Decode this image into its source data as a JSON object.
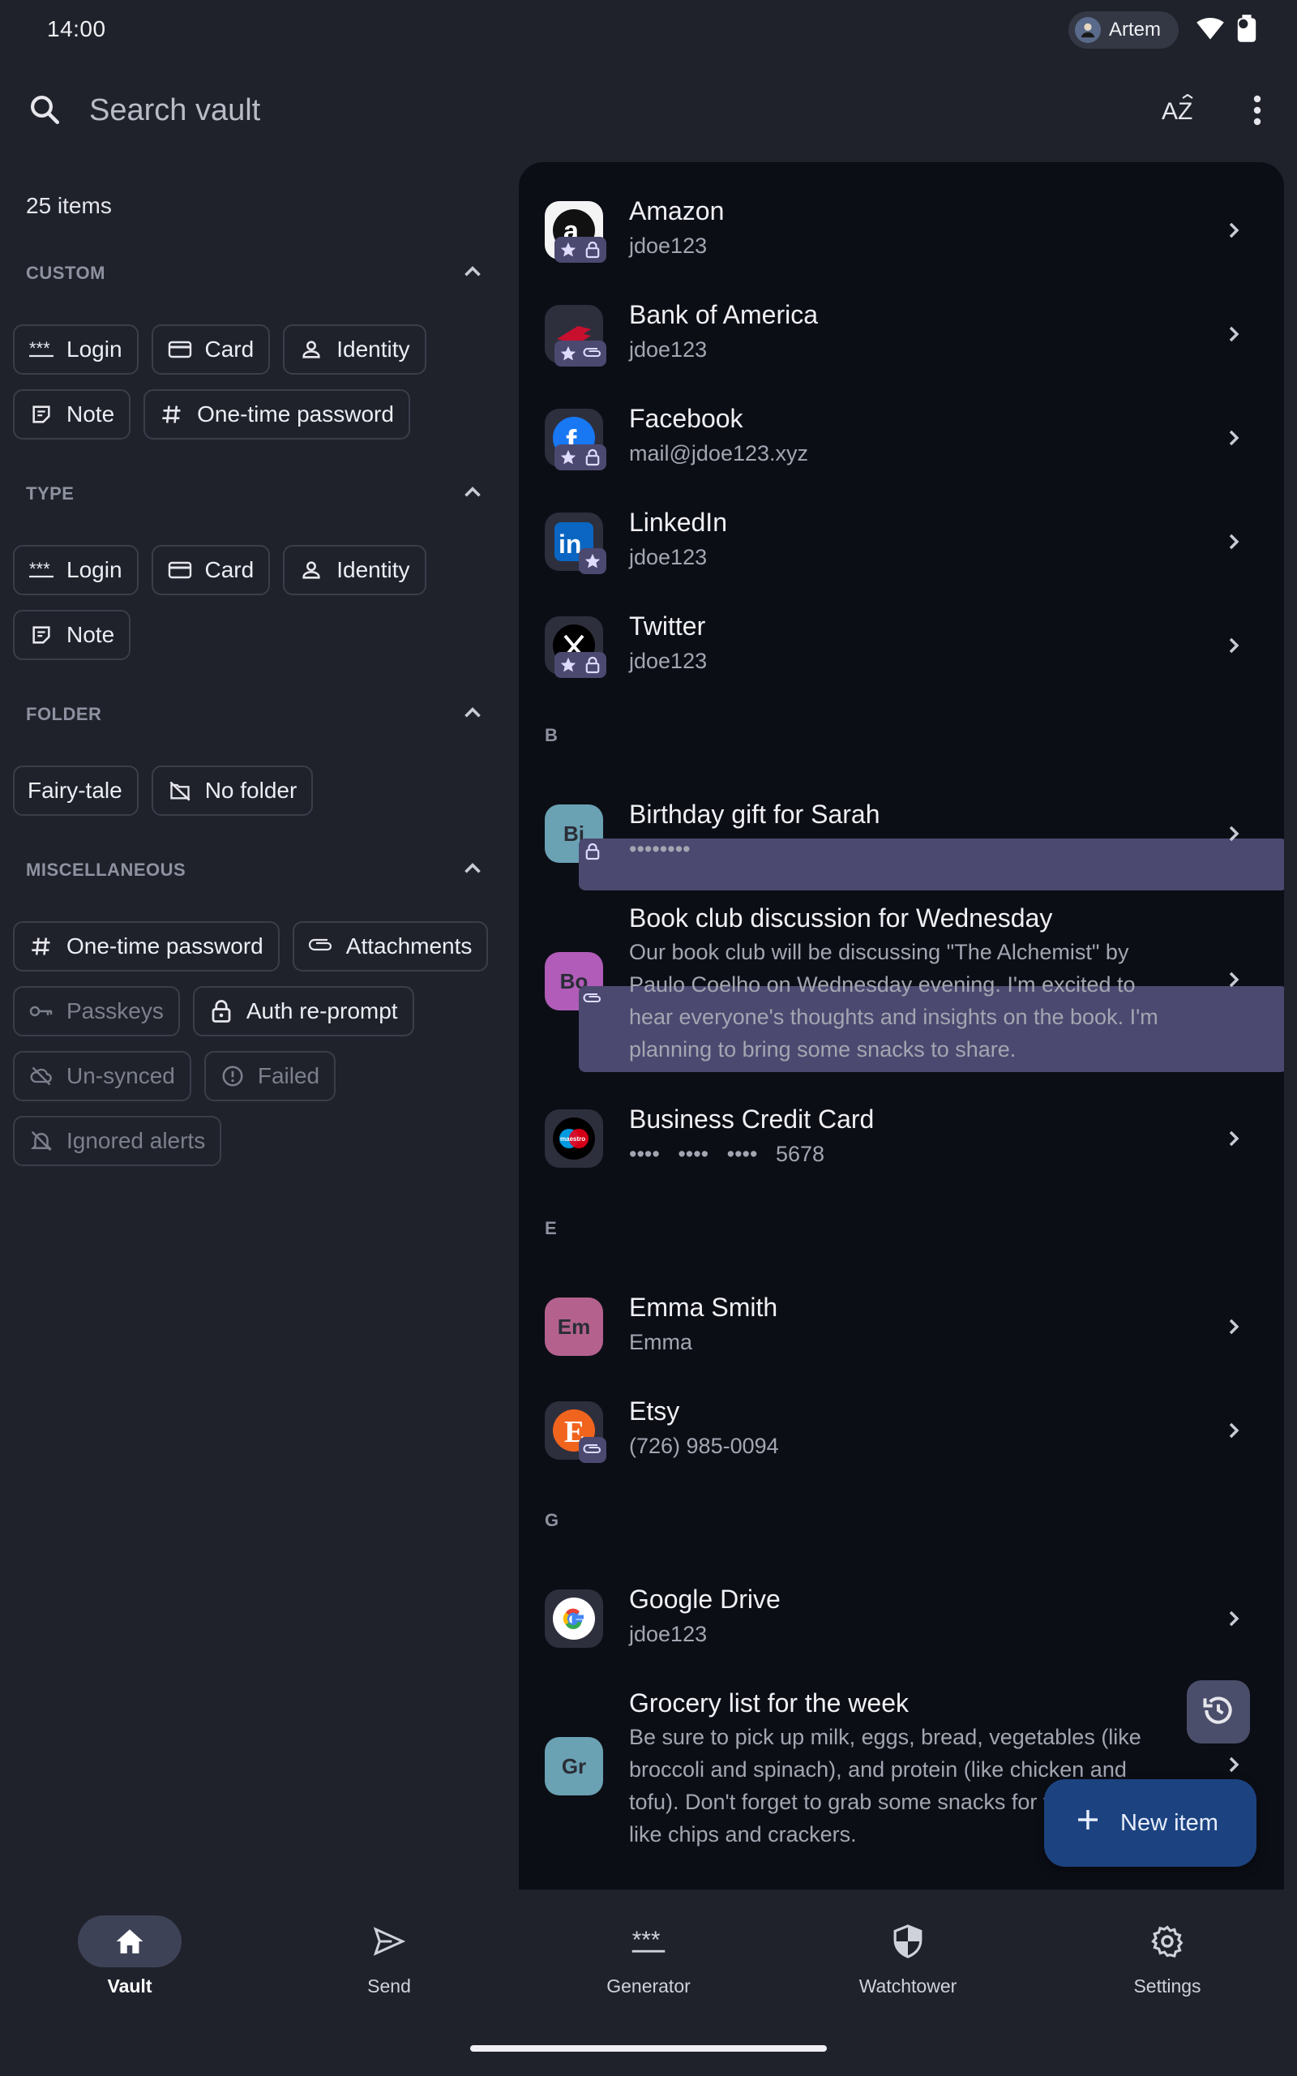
{
  "status_bar": {
    "time": "14:00",
    "user_chip": "Artem",
    "icons": [
      "wifi-icon",
      "battery-icon"
    ]
  },
  "top_bar": {
    "search_placeholder": "Search vault",
    "sort_icon_text": "AZ",
    "more_icon": "more-vert-icon"
  },
  "filters": {
    "items_count": "25 items",
    "sections": {
      "custom": {
        "title": "CUSTOM",
        "chips": [
          {
            "label": "Login",
            "icon": "login-dots-icon"
          },
          {
            "label": "Card",
            "icon": "card-icon"
          },
          {
            "label": "Identity",
            "icon": "person-icon"
          },
          {
            "label": "Note",
            "icon": "note-icon"
          },
          {
            "label": "One-time password",
            "icon": "hash-icon"
          }
        ]
      },
      "type": {
        "title": "TYPE",
        "chips": [
          {
            "label": "Login",
            "icon": "login-dots-icon"
          },
          {
            "label": "Card",
            "icon": "card-icon"
          },
          {
            "label": "Identity",
            "icon": "person-icon"
          },
          {
            "label": "Note",
            "icon": "note-icon"
          }
        ]
      },
      "folder": {
        "title": "FOLDER",
        "chips": [
          {
            "label": "Fairy-tale",
            "icon": ""
          },
          {
            "label": "No folder",
            "icon": "folder-off-icon"
          }
        ]
      },
      "misc": {
        "title": "MISCELLANEOUS",
        "chips": [
          {
            "label": "One-time password",
            "icon": "hash-icon",
            "enabled": true
          },
          {
            "label": "Attachments",
            "icon": "paperclip-icon",
            "enabled": true
          },
          {
            "label": "Passkeys",
            "icon": "key-icon",
            "enabled": false
          },
          {
            "label": "Auth re-prompt",
            "icon": "lock-icon",
            "enabled": true
          },
          {
            "label": "Un-synced",
            "icon": "cloud-off-icon",
            "enabled": false
          },
          {
            "label": "Failed",
            "icon": "error-icon",
            "enabled": false
          },
          {
            "label": "Ignored alerts",
            "icon": "bell-off-icon",
            "enabled": false
          }
        ]
      }
    }
  },
  "list": {
    "section_letters": [
      "B",
      "E",
      "G"
    ],
    "items": [
      {
        "title": "Amazon",
        "subtitle": "jdoe123",
        "avatar": "a",
        "badges": [
          "star",
          "lock"
        ]
      },
      {
        "title": "Bank of America",
        "subtitle": "jdoe123",
        "avatar": "",
        "badges": [
          "star",
          "paperclip"
        ]
      },
      {
        "title": "Facebook",
        "subtitle": "mail@jdoe123.xyz",
        "avatar": "f",
        "badges": [
          "star",
          "lock"
        ]
      },
      {
        "title": "LinkedIn",
        "subtitle": "jdoe123",
        "avatar": "in",
        "badges": [
          "star"
        ]
      },
      {
        "title": "Twitter",
        "subtitle": "jdoe123",
        "avatar": "X",
        "badges": [
          "star",
          "lock"
        ]
      },
      {
        "title": "Birthday gift for Sarah",
        "subtitle": "••••••••",
        "avatar": "Bi",
        "badges": [
          "lock"
        ]
      },
      {
        "title": "Book club discussion for Wednesday",
        "subtitle": "Our book club will be discussing \"The Alchemist\" by Paulo Coelho on Wednesday evening. I'm excited to hear everyone's thoughts and insights on the book. I'm planning to bring some snacks to share.",
        "avatar": "Bo",
        "badges": [
          "paperclip"
        ]
      },
      {
        "title": "Business Credit Card",
        "subtitle": "••••   ••••   ••••   5678",
        "avatar": "maestro",
        "badges": []
      },
      {
        "title": "Emma Smith",
        "subtitle": "Emma",
        "avatar": "Em",
        "badges": []
      },
      {
        "title": "Etsy",
        "subtitle": "(726) 985-0094",
        "avatar": "E",
        "badges": [
          "paperclip"
        ]
      },
      {
        "title": "Google Drive",
        "subtitle": "jdoe123",
        "avatar": "G",
        "badges": []
      },
      {
        "title": "Grocery list for the week",
        "subtitle": "Be sure to pick up milk, eggs, bread, vegetables (like broccoli and spinach), and protein (like chicken and tofu). Don't forget to grab some snacks for the week too, like chips and crackers.",
        "avatar": "Gr",
        "badges": []
      }
    ]
  },
  "fab": {
    "new_item": "New item",
    "history_icon": "history-icon"
  },
  "bottom_nav": [
    {
      "label": "Vault",
      "icon": "home-icon",
      "active": true
    },
    {
      "label": "Send",
      "icon": "send-icon",
      "active": false
    },
    {
      "label": "Generator",
      "icon": "password-generator-icon",
      "active": false
    },
    {
      "label": "Watchtower",
      "icon": "shield-icon",
      "active": false
    },
    {
      "label": "Settings",
      "icon": "gear-icon",
      "active": false
    }
  ],
  "colors": {
    "background": "#1f222b",
    "list_background": "#0c0e16",
    "fab": "#1c4380",
    "nav_active": "#3e4257"
  }
}
